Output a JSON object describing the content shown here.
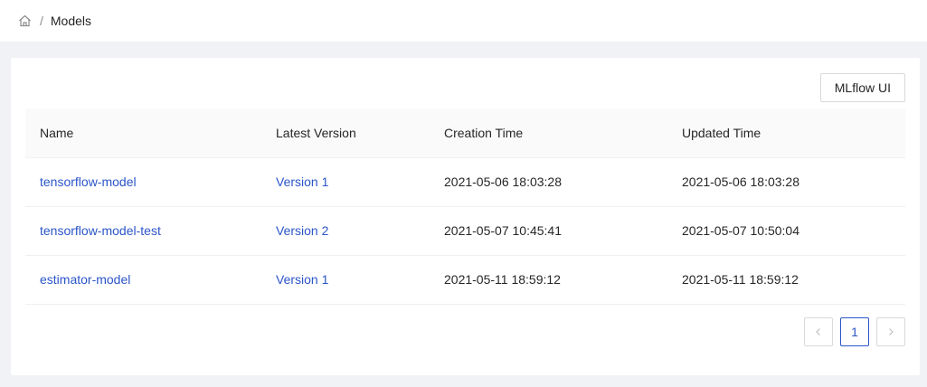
{
  "breadcrumb": {
    "separator": "/",
    "current": "Models"
  },
  "toolbar": {
    "mlflow_label": "MLflow UI"
  },
  "table": {
    "headers": [
      "Name",
      "Latest Version",
      "Creation Time",
      "Updated Time"
    ],
    "rows": [
      {
        "name": "tensorflow-model",
        "version": "Version 1",
        "created": "2021-05-06 18:03:28",
        "updated": "2021-05-06 18:03:28"
      },
      {
        "name": "tensorflow-model-test",
        "version": "Version 2",
        "created": "2021-05-07 10:45:41",
        "updated": "2021-05-07 10:50:04"
      },
      {
        "name": "estimator-model",
        "version": "Version 1",
        "created": "2021-05-11 18:59:12",
        "updated": "2021-05-11 18:59:12"
      }
    ]
  },
  "pagination": {
    "prev_icon": "chevron-left-icon",
    "current_page": "1",
    "next_icon": "chevron-right-icon"
  },
  "colors": {
    "link": "#2b55c9",
    "background": "#f0f2f5"
  }
}
